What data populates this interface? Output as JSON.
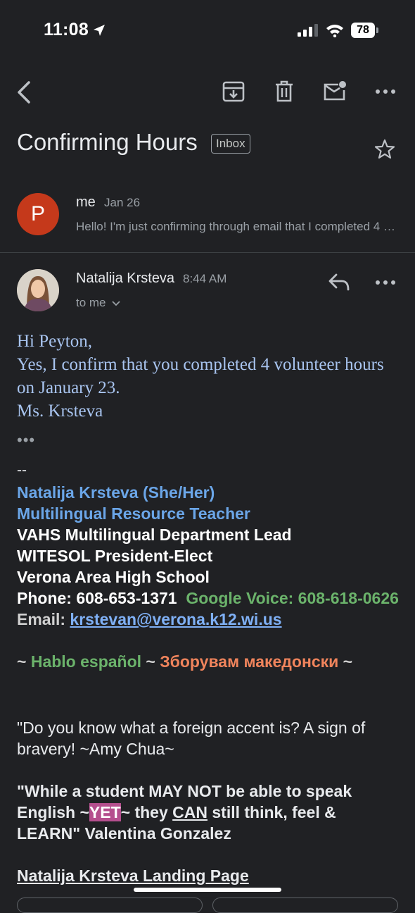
{
  "status": {
    "time": "11:08",
    "battery": "78"
  },
  "subject": "Confirming Hours",
  "label": "Inbox",
  "thread": [
    {
      "avatar_letter": "P",
      "sender": "me",
      "date": "Jan 26",
      "snippet": "Hello! I'm just confirming through email that I completed 4 volunteer hours"
    },
    {
      "sender": "Natalija Krsteva",
      "time": "8:44 AM",
      "recipient": "to me"
    }
  ],
  "message": {
    "greeting": "Hi Peyton,",
    "body": "Yes, I confirm that you completed 4 volunteer hours on January 23.",
    "closing": "Ms. Krsteva",
    "expand": "•••"
  },
  "signature": {
    "separator": "--",
    "name": "Natalija Krsteva (She/Her)",
    "title": "Multilingual Resource Teacher",
    "role": "VAHS Multilingual Department Lead",
    "org_role": "WITESOL President-Elect",
    "school": "Verona Area High School",
    "phone_label": "Phone: 608-653-1371",
    "voice_label": "Google Voice: 608-618-0626",
    "email_label": "Email:",
    "email": "krstevan@verona.k12.wi.us",
    "tilde": "~",
    "spanish": "Hablo español",
    "macedonian": "Зборувам македонски",
    "quote1": "\"Do you know what a foreign accent is? A sign of bravery! ~Amy Chua~",
    "quote2_a": "\"While a student MAY NOT be able to speak English ~",
    "quote2_yet": "YET",
    "quote2_b": "~ they ",
    "quote2_can": "CAN",
    "quote2_c": " still think, feel & LEARN\" Valentina Gonzalez",
    "landing_link": "Natalija Krsteva Landing Page"
  }
}
